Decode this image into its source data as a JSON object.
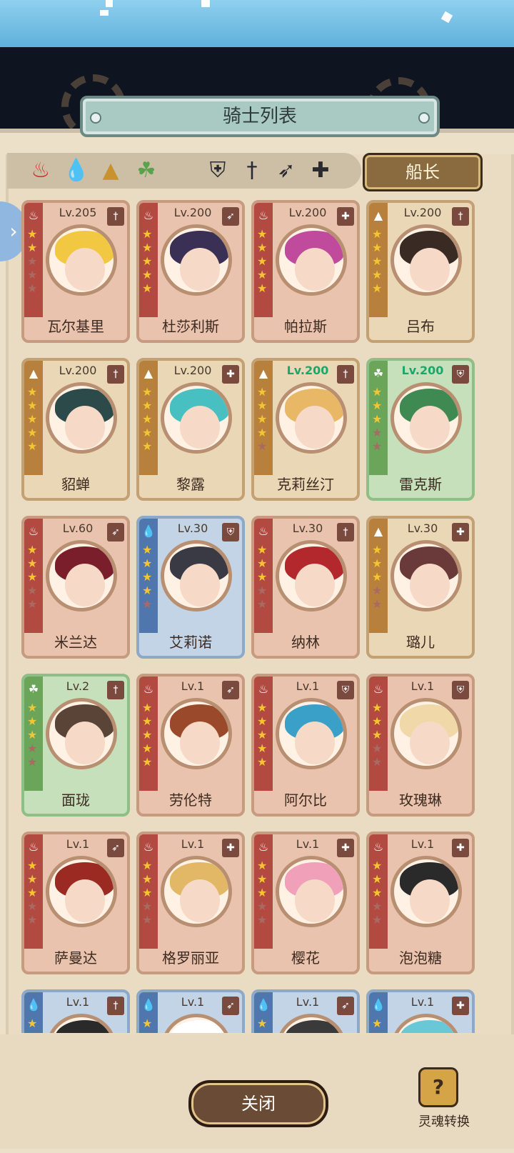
{
  "header": {
    "title": "骑士列表"
  },
  "filters": {
    "elements": [
      "fire-icon",
      "water-icon",
      "earth-icon",
      "wind-icon"
    ],
    "classes": [
      "shield-icon",
      "sword-icon",
      "bow-icon",
      "cross-icon"
    ],
    "captain_label": "船长"
  },
  "knights": [
    {
      "name": "瓦尔基里",
      "lv": "Lv.205",
      "el": "fire",
      "cls": "sword",
      "stars": 2,
      "c": "red",
      "hair": "#f2c741",
      "max": false
    },
    {
      "name": "杜莎利斯",
      "lv": "Lv.200",
      "el": "fire",
      "cls": "bow",
      "stars": 5,
      "c": "red",
      "hair": "#3a2f55",
      "max": false
    },
    {
      "name": "帕拉斯",
      "lv": "Lv.200",
      "el": "fire",
      "cls": "cross",
      "stars": 5,
      "c": "red",
      "hair": "#c04a9c",
      "max": false
    },
    {
      "name": "吕布",
      "lv": "Lv.200",
      "el": "earth",
      "cls": "sword",
      "stars": 5,
      "c": "gold",
      "hair": "#3a2a24",
      "max": false
    },
    {
      "name": "貂蝉",
      "lv": "Lv.200",
      "el": "earth",
      "cls": "sword",
      "stars": 5,
      "c": "gold",
      "hair": "#2c4a4a",
      "max": false
    },
    {
      "name": "黎露",
      "lv": "Lv.200",
      "el": "earth",
      "cls": "cross",
      "stars": 5,
      "c": "gold",
      "hair": "#48c0c2",
      "max": false
    },
    {
      "name": "克莉丝汀",
      "lv": "Lv.200",
      "el": "earth",
      "cls": "sword",
      "stars": 4,
      "c": "gold",
      "hair": "#e8b866",
      "max": true
    },
    {
      "name": "雷克斯",
      "lv": "Lv.200",
      "el": "wind",
      "cls": "shield",
      "stars": 3,
      "c": "green",
      "hair": "#3f8a52",
      "max": true
    },
    {
      "name": "米兰达",
      "lv": "Lv.60",
      "el": "fire",
      "cls": "bow",
      "stars": 3,
      "c": "red",
      "hair": "#7a1e2c",
      "max": false
    },
    {
      "name": "艾莉诺",
      "lv": "Lv.30",
      "el": "water",
      "cls": "shield",
      "stars": 4,
      "c": "blue",
      "hair": "#3a3a44",
      "max": false
    },
    {
      "name": "纳林",
      "lv": "Lv.30",
      "el": "fire",
      "cls": "sword",
      "stars": 3,
      "c": "red",
      "hair": "#b3282c",
      "max": false
    },
    {
      "name": "璐儿",
      "lv": "Lv.30",
      "el": "earth",
      "cls": "cross",
      "stars": 3,
      "c": "gold",
      "hair": "#6a3a3a",
      "max": false
    },
    {
      "name": "面珑",
      "lv": "Lv.2",
      "el": "wind",
      "cls": "sword",
      "stars": 3,
      "c": "green",
      "hair": "#5a4438",
      "max": false
    },
    {
      "name": "劳伦特",
      "lv": "Lv.1",
      "el": "fire",
      "cls": "bow",
      "stars": 5,
      "c": "red",
      "hair": "#9a4a2a",
      "max": false
    },
    {
      "name": "阿尔比",
      "lv": "Lv.1",
      "el": "fire",
      "cls": "shield",
      "stars": 5,
      "c": "red",
      "hair": "#3aa0c8",
      "max": false
    },
    {
      "name": "玫瑰琳",
      "lv": "Lv.1",
      "el": "fire",
      "cls": "shield",
      "stars": 3,
      "c": "red",
      "hair": "#f0d8a8",
      "max": false
    },
    {
      "name": "萨曼达",
      "lv": "Lv.1",
      "el": "fire",
      "cls": "bow",
      "stars": 3,
      "c": "red",
      "hair": "#9a2a22",
      "max": false
    },
    {
      "name": "格罗丽亚",
      "lv": "Lv.1",
      "el": "fire",
      "cls": "cross",
      "stars": 3,
      "c": "red",
      "hair": "#e2b866",
      "max": false
    },
    {
      "name": "樱花",
      "lv": "Lv.1",
      "el": "fire",
      "cls": "cross",
      "stars": 3,
      "c": "red",
      "hair": "#f0a0b8",
      "max": false
    },
    {
      "name": "泡泡糖",
      "lv": "Lv.1",
      "el": "fire",
      "cls": "cross",
      "stars": 3,
      "c": "red",
      "hair": "#2a2a2a",
      "max": false
    },
    {
      "name": "",
      "lv": "Lv.1",
      "el": "water",
      "cls": "sword",
      "stars": 1,
      "c": "blue",
      "hair": "#2a2a2a",
      "max": false
    },
    {
      "name": "",
      "lv": "Lv.1",
      "el": "water",
      "cls": "bow",
      "stars": 1,
      "c": "blue",
      "hair": "#ffffff",
      "max": false
    },
    {
      "name": "",
      "lv": "Lv.1",
      "el": "water",
      "cls": "bow",
      "stars": 1,
      "c": "blue",
      "hair": "#3a3a3a",
      "max": false
    },
    {
      "name": "",
      "lv": "Lv.1",
      "el": "water",
      "cls": "cross",
      "stars": 1,
      "c": "blue",
      "hair": "#68c8d8",
      "max": false
    }
  ],
  "footer": {
    "close_label": "关闭",
    "soul_label": "灵魂转换",
    "soul_icon_text": "?"
  }
}
